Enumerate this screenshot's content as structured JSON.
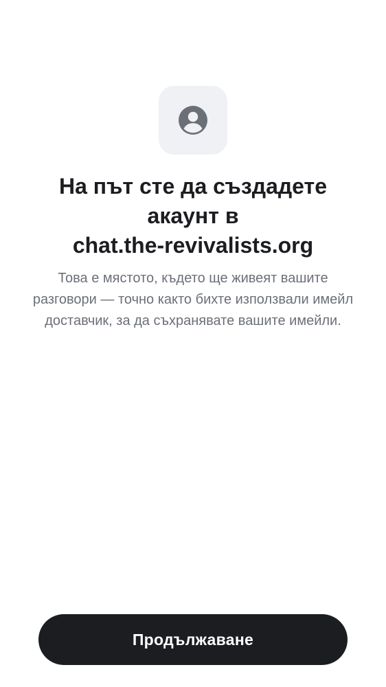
{
  "header_icon": "user-avatar-icon",
  "title": {
    "line1": "На път сте да създадете",
    "line2": "акаунт в",
    "line3": "chat.the-revivalists.org"
  },
  "description": "Това е мястото, където ще живеят вашите разговори — точно както бихте използвали имейл доставчик, за да съхранявате вашите имейли.",
  "continue_button": {
    "label": "Продължаване"
  },
  "colors": {
    "background": "#ffffff",
    "tile_background": "#eff1f5",
    "icon": "#6b6f77",
    "title": "#1c1d21",
    "description": "#6b6f77",
    "button_background": "#1c1d21",
    "button_text": "#ffffff"
  }
}
